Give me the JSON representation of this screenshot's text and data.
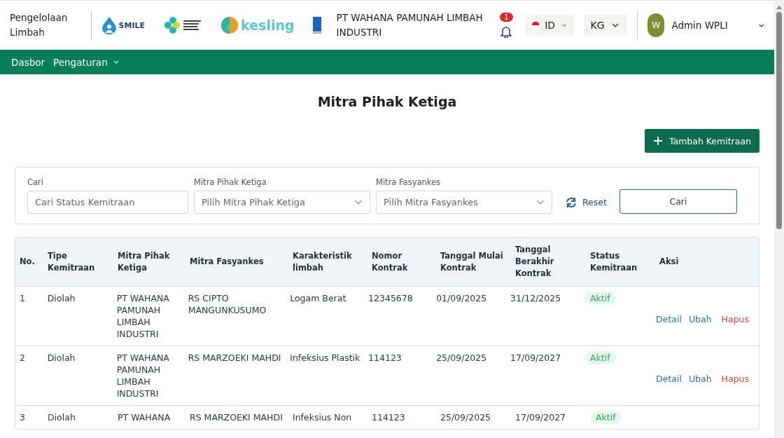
{
  "header": {
    "app_title": "Pengelolaan Limbah",
    "logos": [
      {
        "kind": "smile",
        "text": "SMILE"
      },
      {
        "kind": "kemenkes"
      },
      {
        "kind": "kesling",
        "text": "kesling"
      },
      {
        "kind": "undp"
      }
    ],
    "company": "PT WAHANA PAMUNAH LIMBAH INDUSTRI",
    "notification_count": "1",
    "language": "ID",
    "unit": "KG",
    "user": {
      "initial": "W",
      "name": "Admin WPLI"
    }
  },
  "nav": [
    {
      "label": "Dasbor",
      "dropdown": false
    },
    {
      "label": "Pengaturan",
      "dropdown": true
    }
  ],
  "page_title": "Mitra Pihak Ketiga",
  "add_button": "Tambah Kemitraan",
  "filters": [
    {
      "kind": "text",
      "label": "Cari",
      "placeholder": "Cari Status Kemitraan"
    },
    {
      "kind": "select",
      "label": "Mitra Pihak Ketiga",
      "placeholder": "Pilih Mitra Pihak Ketiga"
    },
    {
      "kind": "select",
      "label": "Mitra Fasyankes",
      "placeholder": "Pilih Mitra Fasyankes"
    }
  ],
  "reset_button": "Reset",
  "search_button": "Cari",
  "table": {
    "columns": [
      "No.",
      "Tipe Kemitraan",
      "Mitra Pihak Ketiga",
      "Mitra Fasyankes",
      "Karakteristik limbah",
      "Nomor Kontrak",
      "Tanggal Mulai Kontrak",
      "Tanggal Berakhir Kontrak",
      "Status Kemitraan",
      "Aksi"
    ],
    "rows": [
      {
        "cells": [
          "1",
          "Diolah",
          "PT WAHANA PAMUNAH LIMBAH INDUSTRI",
          "RS CIPTO MANGUNKUSUMO",
          "Logam Berat",
          "12345678",
          "01/09/2025",
          "31/12/2025"
        ],
        "status": "Aktif",
        "actions": [
          {
            "kind": "view",
            "label": "Detail"
          },
          {
            "kind": "edit",
            "label": "Ubah"
          },
          {
            "kind": "delete",
            "label": "Hapus"
          }
        ]
      },
      {
        "cells": [
          "2",
          "Diolah",
          "PT WAHANA PAMUNAH LIMBAH INDUSTRI",
          "RS MARZOEKI MAHDI",
          "Infeksius Plastik",
          "114123",
          "25/09/2025",
          "17/09/2027"
        ],
        "status": "Aktif",
        "actions": [
          {
            "kind": "view",
            "label": "Detail"
          },
          {
            "kind": "edit",
            "label": "Ubah"
          },
          {
            "kind": "delete",
            "label": "Hapus"
          }
        ]
      },
      {
        "cells": [
          "3",
          "Diolah",
          "PT WAHANA",
          "RS MARZOEKI MAHDI",
          "Infeksius Non",
          "114123",
          "25/09/2025",
          "17/09/2027"
        ],
        "status": "Aktif",
        "actions": []
      }
    ]
  }
}
